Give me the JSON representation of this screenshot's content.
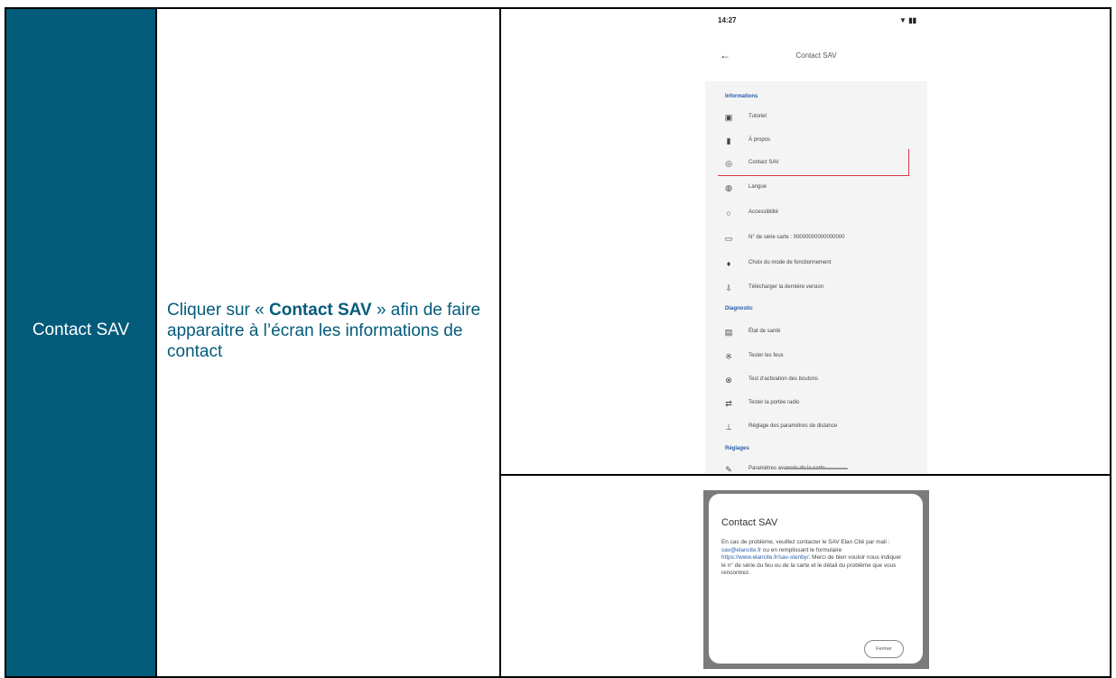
{
  "step": {
    "label": "Contact SAV"
  },
  "description": {
    "prefix": "Cliquer sur « ",
    "bold": "Contact SAV",
    "suffix": " » afin de faire apparaitre à l’écran les informations de contact"
  },
  "phone": {
    "status_time": "14:27",
    "status_icons": "▼ ▮▮",
    "title": "Contact SAV",
    "sections": [
      {
        "title": "Informations",
        "items": [
          {
            "icon": "tutorial-icon",
            "label": "Tutoriel"
          },
          {
            "icon": "about-icon",
            "label": "À propos"
          },
          {
            "icon": "support-icon",
            "label": "Contact SAV"
          },
          {
            "icon": "language-icon",
            "label": "Langue"
          },
          {
            "icon": "accessibility-icon",
            "label": "Accessibilité"
          },
          {
            "icon": "device-icon",
            "label": "N° de série carte : 00000000000000000"
          },
          {
            "icon": "firmware-icon",
            "label": "Choix du mode de fonctionnement"
          },
          {
            "icon": "download-icon",
            "label": "Télécharger la dernière version"
          }
        ]
      },
      {
        "title": "Diagnostic",
        "items": [
          {
            "icon": "health-icon",
            "label": "État de santé"
          },
          {
            "icon": "test-lamp-icon",
            "label": "Tester les feux"
          },
          {
            "icon": "test-button-icon",
            "label": "Test d’activation des boutons"
          },
          {
            "icon": "test-radio-icon",
            "label": "Tester la portée radio"
          },
          {
            "icon": "settings-icon",
            "label": "Réglage des paramètres de distance"
          }
        ]
      },
      {
        "title": "Réglages",
        "items": [
          {
            "icon": "edit-icon",
            "label": "Paramètres avancés de la carte"
          }
        ]
      }
    ]
  },
  "dialog": {
    "title": "Contact SAV",
    "body_1": "En cas de problème, veuillez contacter le SAV Elan Cité par mail : ",
    "email": "sav@elancite.fr",
    "body_2": " ou en remplissant le formulaire ",
    "url": "https://www.elancite.fr/sav-stenby/",
    "body_3": ". Merci de bien vouloir nous indiquer le n° de série du feu ou de la carte et le détail du problème que vous rencontrez.",
    "close_label": "Fermer"
  }
}
